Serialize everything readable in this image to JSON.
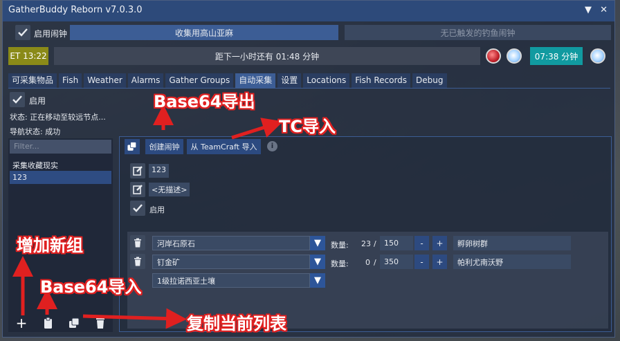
{
  "window": {
    "title": "GatherBuddy Reborn v7.0.3.0",
    "controls": "▼ ✕"
  },
  "top": {
    "alarm_label": "启用闹钟",
    "gather_bar": "收集用高山亚麻",
    "fish_bar": "无已触发的钓鱼闹钟",
    "et_time": "ET 13:22",
    "next_hour": "距下一小时还有 01:48 分钟",
    "timer": "07:38 分钟"
  },
  "tabs": [
    "可采集物品",
    "Fish",
    "Weather",
    "Alarms",
    "Gather Groups",
    "自动采集",
    "设置",
    "Locations",
    "Fish Records",
    "Debug"
  ],
  "active_tab": "自动采集",
  "status": {
    "enable_label": "启用",
    "state": "状态: 正在移动至较远节点...",
    "nav_state": "导航状态: 成功"
  },
  "sidebar": {
    "filter_placeholder": "Filter...",
    "groups": [
      "采集收藏现实",
      "123"
    ],
    "selected": "123"
  },
  "toolbar": {
    "create_alarm": "创建闹钟",
    "import_teamcraft": "从 TeamCraft 导入",
    "info": "i"
  },
  "preset": {
    "name": "123",
    "description": "<无描述>",
    "enabled_label": "启用"
  },
  "items": [
    {
      "name": "河岸石原石",
      "qty_label": "数量:",
      "current": "23",
      "total": "150",
      "location": "孵卵树群"
    },
    {
      "name": "钉金矿",
      "qty_label": "数量:",
      "current": "0",
      "total": "350",
      "location": "帕利尤南沃野"
    },
    {
      "name": "1级拉诺西亚土壤"
    }
  ],
  "annotations": {
    "export": "Base64导出",
    "tc_import": "TC导入",
    "add_group": "增加新组",
    "import": "Base64导入",
    "copy_list": "复制当前列表"
  },
  "colors": {
    "accent": "#2d4a7a",
    "et_bg": "#8a8a18",
    "timer_bg": "#119aa0",
    "annotation_red": "#e02020"
  }
}
